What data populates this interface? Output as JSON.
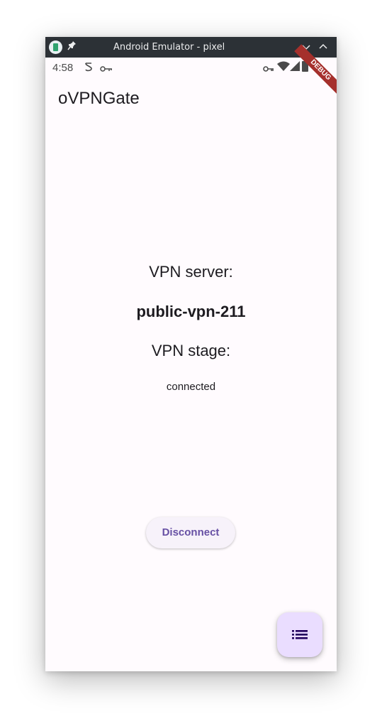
{
  "window": {
    "title": "Android Emulator - pixel"
  },
  "status_bar": {
    "time": "4:58"
  },
  "debug_banner": "DEBUG",
  "app_bar": {
    "title": "oVPNGate"
  },
  "main": {
    "server_label": "VPN server:",
    "server_value": "public-vpn-211",
    "stage_label": "VPN stage:",
    "stage_value": "connected",
    "disconnect_label": "Disconnect"
  },
  "colors": {
    "titlebar_bg": "#2c3136",
    "app_bg": "#fffbfe",
    "primary": "#6750a4",
    "fab_bg": "#eaddff",
    "debug_banner": "#a5302c"
  },
  "icons": {
    "fab": "list-icon"
  }
}
